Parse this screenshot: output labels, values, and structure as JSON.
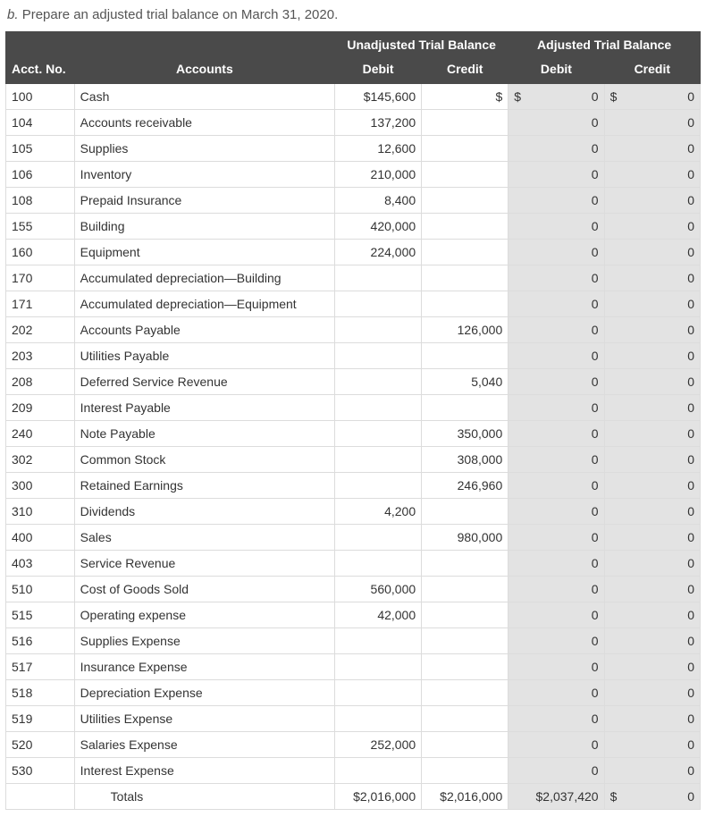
{
  "prompt_label": "b.",
  "prompt_text": "Prepare an adjusted trial balance on March 31, 2020.",
  "headers": {
    "group_unadj": "Unadjusted Trial Balance",
    "group_adj": "Adjusted Trial Balance",
    "acct_no": "Acct. No.",
    "accounts": "Accounts",
    "debit": "Debit",
    "credit": "Credit"
  },
  "currency": "$",
  "rows": [
    {
      "acct": "100",
      "name": "Cash",
      "ud": "$145,600",
      "uc": "$",
      "ad": "0",
      "ac": "0",
      "ud_sym": true,
      "uc_sym_only": true,
      "ad_sym": true,
      "ac_sym": true
    },
    {
      "acct": "104",
      "name": "Accounts receivable",
      "ud": "137,200",
      "uc": "",
      "ad": "0",
      "ac": "0"
    },
    {
      "acct": "105",
      "name": "Supplies",
      "ud": "12,600",
      "uc": "",
      "ad": "0",
      "ac": "0"
    },
    {
      "acct": "106",
      "name": "Inventory",
      "ud": "210,000",
      "uc": "",
      "ad": "0",
      "ac": "0"
    },
    {
      "acct": "108",
      "name": "Prepaid Insurance",
      "ud": "8,400",
      "uc": "",
      "ad": "0",
      "ac": "0"
    },
    {
      "acct": "155",
      "name": "Building",
      "ud": "420,000",
      "uc": "",
      "ad": "0",
      "ac": "0"
    },
    {
      "acct": "160",
      "name": "Equipment",
      "ud": "224,000",
      "uc": "",
      "ad": "0",
      "ac": "0"
    },
    {
      "acct": "170",
      "name": "Accumulated depreciation—Building",
      "ud": "",
      "uc": "",
      "ad": "0",
      "ac": "0"
    },
    {
      "acct": "171",
      "name": "Accumulated depreciation—Equipment",
      "ud": "",
      "uc": "",
      "ad": "0",
      "ac": "0"
    },
    {
      "acct": "202",
      "name": "Accounts Payable",
      "ud": "",
      "uc": "126,000",
      "ad": "0",
      "ac": "0"
    },
    {
      "acct": "203",
      "name": "Utilities Payable",
      "ud": "",
      "uc": "",
      "ad": "0",
      "ac": "0"
    },
    {
      "acct": "208",
      "name": "Deferred Service Revenue",
      "ud": "",
      "uc": "5,040",
      "ad": "0",
      "ac": "0"
    },
    {
      "acct": "209",
      "name": "Interest Payable",
      "ud": "",
      "uc": "",
      "ad": "0",
      "ac": "0"
    },
    {
      "acct": "240",
      "name": "Note Payable",
      "ud": "",
      "uc": "350,000",
      "ad": "0",
      "ac": "0"
    },
    {
      "acct": "302",
      "name": "Common Stock",
      "ud": "",
      "uc": "308,000",
      "ad": "0",
      "ac": "0"
    },
    {
      "acct": "300",
      "name": "Retained Earnings",
      "ud": "",
      "uc": "246,960",
      "ad": "0",
      "ac": "0"
    },
    {
      "acct": "310",
      "name": "Dividends",
      "ud": "4,200",
      "uc": "",
      "ad": "0",
      "ac": "0"
    },
    {
      "acct": "400",
      "name": "Sales",
      "ud": "",
      "uc": "980,000",
      "ad": "0",
      "ac": "0"
    },
    {
      "acct": "403",
      "name": "Service Revenue",
      "ud": "",
      "uc": "",
      "ad": "0",
      "ac": "0"
    },
    {
      "acct": "510",
      "name": "Cost of Goods Sold",
      "ud": "560,000",
      "uc": "",
      "ad": "0",
      "ac": "0"
    },
    {
      "acct": "515",
      "name": "Operating expense",
      "ud": "42,000",
      "uc": "",
      "ad": "0",
      "ac": "0"
    },
    {
      "acct": "516",
      "name": "Supplies Expense",
      "ud": "",
      "uc": "",
      "ad": "0",
      "ac": "0"
    },
    {
      "acct": "517",
      "name": "Insurance Expense",
      "ud": "",
      "uc": "",
      "ad": "0",
      "ac": "0"
    },
    {
      "acct": "518",
      "name": "Depreciation Expense",
      "ud": "",
      "uc": "",
      "ad": "0",
      "ac": "0"
    },
    {
      "acct": "519",
      "name": "Utilities Expense",
      "ud": "",
      "uc": "",
      "ad": "0",
      "ac": "0"
    },
    {
      "acct": "520",
      "name": "Salaries Expense",
      "ud": "252,000",
      "uc": "",
      "ad": "0",
      "ac": "0"
    },
    {
      "acct": "530",
      "name": "Interest Expense",
      "ud": "",
      "uc": "",
      "ad": "0",
      "ac": "0"
    }
  ],
  "totals": {
    "label": "Totals",
    "ud": "$2,016,000",
    "uc": "$2,016,000",
    "ad": "$2,037,420",
    "ac": "0",
    "ac_sym": true
  }
}
